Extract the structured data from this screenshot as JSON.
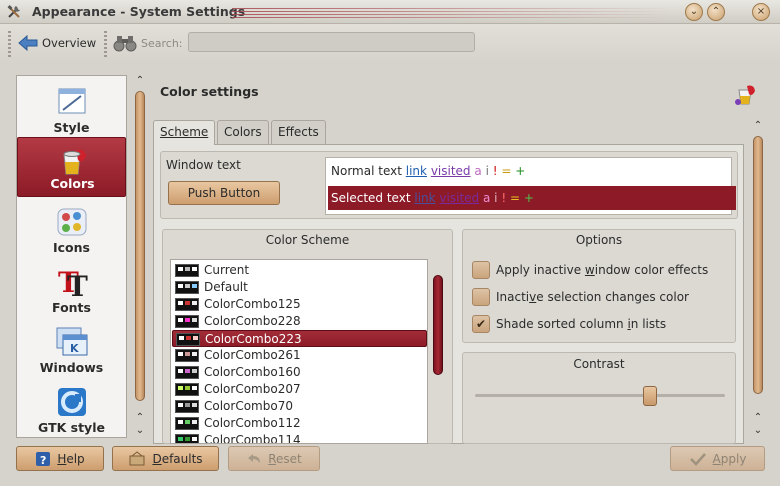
{
  "window": {
    "title": "Appearance - System Settings",
    "minimize_glyph": "⌄",
    "close_glyph": "×"
  },
  "toolbar": {
    "overview_label": "Overview",
    "search_label": "Search:",
    "search_value": ""
  },
  "sidebar": {
    "items": [
      {
        "label": "Style",
        "icon": "style-icon",
        "selected": false
      },
      {
        "label": "Colors",
        "icon": "colors-icon",
        "selected": true
      },
      {
        "label": "Icons",
        "icon": "icons-icon",
        "selected": false
      },
      {
        "label": "Fonts",
        "icon": "fonts-icon",
        "selected": false
      },
      {
        "label": "Windows",
        "icon": "windows-icon",
        "selected": false
      },
      {
        "label": "GTK style",
        "icon": "gtk-icon",
        "selected": false
      }
    ]
  },
  "main": {
    "title": "Color settings",
    "tabs": [
      {
        "label": "Scheme",
        "active": true
      },
      {
        "label": "Colors",
        "active": false
      },
      {
        "label": "Effects",
        "active": false
      }
    ],
    "preview": {
      "window_text": "Window text",
      "push_button": "Push Button",
      "normal_text": "Normal text",
      "link": "link",
      "visited": "visited",
      "a": "a",
      "i": "i",
      "excl": "!",
      "eq": "=",
      "plus": "+",
      "selected_text": "Selected text"
    },
    "scheme": {
      "title": "Color Scheme",
      "items": [
        "Current",
        "Default",
        "ColorCombo125",
        "ColorCombo228",
        "ColorCombo223",
        "ColorCombo261",
        "ColorCombo160",
        "ColorCombo207",
        "ColorCombo70",
        "ColorCombo112",
        "ColorCombo114"
      ],
      "selected": "ColorCombo223"
    },
    "options": {
      "title": "Options",
      "items": [
        {
          "label_pre": "Apply inactive ",
          "label_key": "w",
          "label_post": "indow color effects",
          "checked": false
        },
        {
          "label_pre": "Inacti",
          "label_key": "v",
          "label_post": "e selection changes color",
          "checked": false
        },
        {
          "label_pre": "Shade sorted column ",
          "label_key": "i",
          "label_post": "n lists",
          "checked": true
        }
      ]
    },
    "contrast": {
      "title": "Contrast",
      "level": 0.7
    }
  },
  "buttons": {
    "help_key": "H",
    "help_rest": "elp",
    "defaults_key": "D",
    "defaults_rest": "efaults",
    "reset_key": "R",
    "reset_rest": "eset",
    "apply_key": "A",
    "apply_rest": "pply"
  },
  "colors": {
    "accent": "#8c1b27",
    "button": "#cd9e6f"
  }
}
